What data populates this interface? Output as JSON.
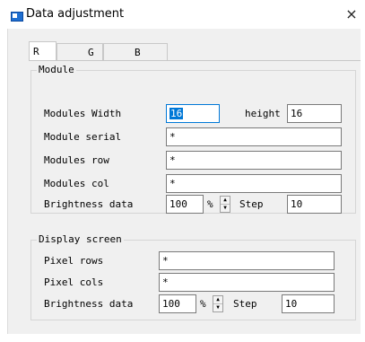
{
  "window": {
    "title": "Data adjustment",
    "close_icon": "×"
  },
  "tabs": [
    {
      "label": "R",
      "active": true
    },
    {
      "label": "G",
      "active": false
    },
    {
      "label": "B",
      "active": false
    }
  ],
  "module": {
    "group_title": "Module",
    "width_label": "Modules Width",
    "width_value": "16",
    "height_label": "height",
    "height_value": "16",
    "serial_label": "Module serial",
    "serial_value": "*",
    "row_label": "Modules row",
    "row_value": "*",
    "col_label": "Modules col",
    "col_value": "*",
    "brightness_label": "Brightness data",
    "brightness_value": "100",
    "percent": "%",
    "step_label": "Step",
    "step_value": "10"
  },
  "display": {
    "group_title": "Display screen",
    "rows_label": "Pixel rows",
    "rows_value": "*",
    "cols_label": "Pixel cols",
    "cols_value": "*",
    "brightness_label": "Brightness data",
    "brightness_value": "100",
    "percent": "%",
    "step_label": "Step",
    "step_value": "10"
  },
  "icons": {
    "spin_up": "▲",
    "spin_down": "▼"
  }
}
